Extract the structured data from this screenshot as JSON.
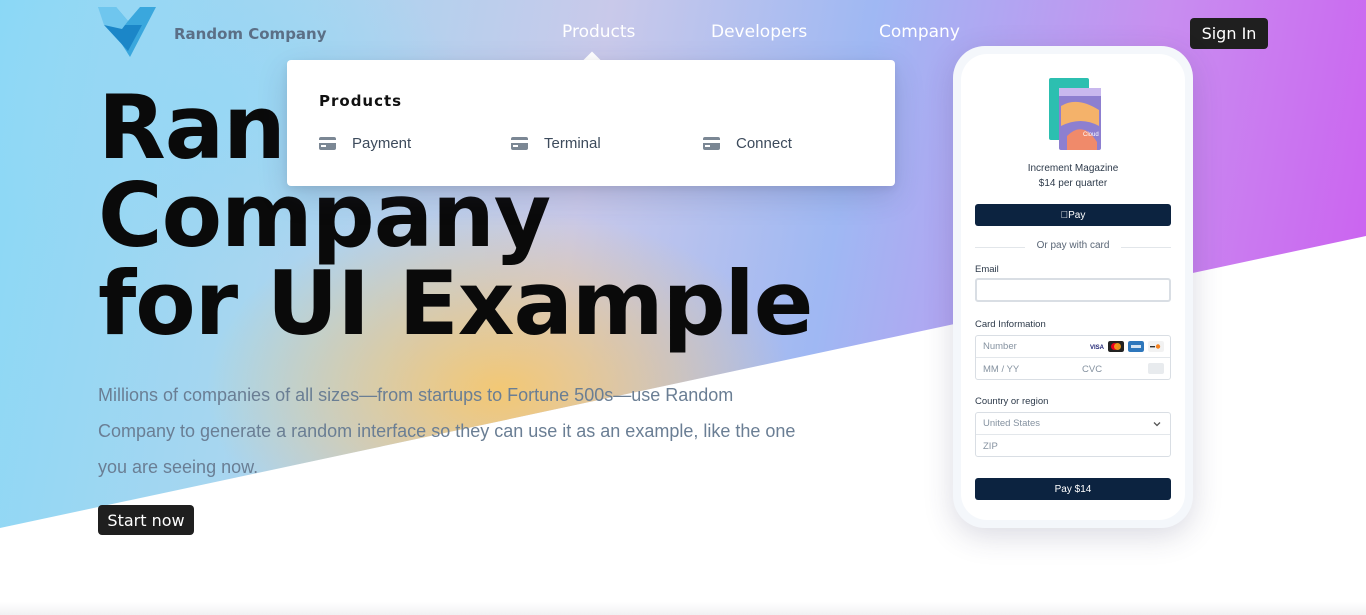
{
  "header": {
    "brand_name": "Random Company",
    "nav": [
      "Products",
      "Developers",
      "Company"
    ],
    "sign_in": "Sign In"
  },
  "dropdown": {
    "title": "Products",
    "items": [
      {
        "label": "Payment",
        "icon": "card-icon"
      },
      {
        "label": "Terminal",
        "icon": "card-icon"
      },
      {
        "label": "Connect",
        "icon": "card-icon"
      }
    ]
  },
  "hero": {
    "headline_line1": "Random",
    "headline_line2": "Company",
    "headline_line3": "for UI Example",
    "description": "Millions of companies of all sizes—from startups to Fortune 500s—use Random Company to generate a random interface so they can use it as an example, like the one you are seeing now.",
    "cta": "Start now"
  },
  "phone": {
    "product_name": "Increment Magazine",
    "price": "$14 per quarter",
    "apple_pay": "Pay",
    "or_text": "Or pay with card",
    "email_label": "Email",
    "email_value": "",
    "card_label": "Card Information",
    "card_number_placeholder": "Number",
    "expiry_placeholder": "MM / YY",
    "cvc_placeholder": "CVC",
    "country_label": "Country or region",
    "country_value": "United States",
    "zip_placeholder": "ZIP",
    "pay_button": "Pay $14",
    "card_brands": [
      "visa",
      "mastercard",
      "amex",
      "discover"
    ]
  },
  "colors": {
    "dark_button": "#1f1f1f",
    "pay_navy": "#0c2340",
    "description_text": "#6a7e94",
    "logo_blue": "#2a9fd8"
  }
}
